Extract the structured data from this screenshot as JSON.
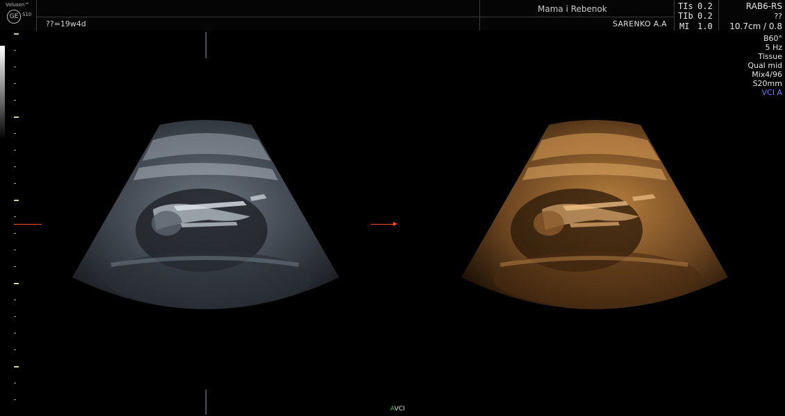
{
  "header": {
    "brand": "Voluson™",
    "logo_glyph": "GE",
    "model": "S10",
    "gest_age": "??=19w4d",
    "institution": "Mama i Rebenok",
    "operator": "SARENKO A.A",
    "indices": {
      "tis_label": "TIs",
      "tis_value": "0.2",
      "tib_label": "TIb",
      "tib_value": "0.2",
      "mi_label": "MI",
      "mi_value": "1.0"
    },
    "probe": "RAB6-RS",
    "probe_sub": "??",
    "depth_info": "10.7cm / 0.8"
  },
  "side_params": {
    "angle": "B60°",
    "frame_rate": "5 Hz",
    "preset": "Tissue",
    "quality": "Qual mid",
    "mix": "Mix4/96",
    "slice": "S20mm",
    "vci": "VCI A"
  },
  "footer": {
    "mark_a": "A",
    "mark_vci": "VCI"
  },
  "colors": {
    "grey_image": "#8a96a3",
    "sepia_image": "#c98a45",
    "focus_marker": "#ff4a20",
    "vci_text": "#6f7cff"
  }
}
